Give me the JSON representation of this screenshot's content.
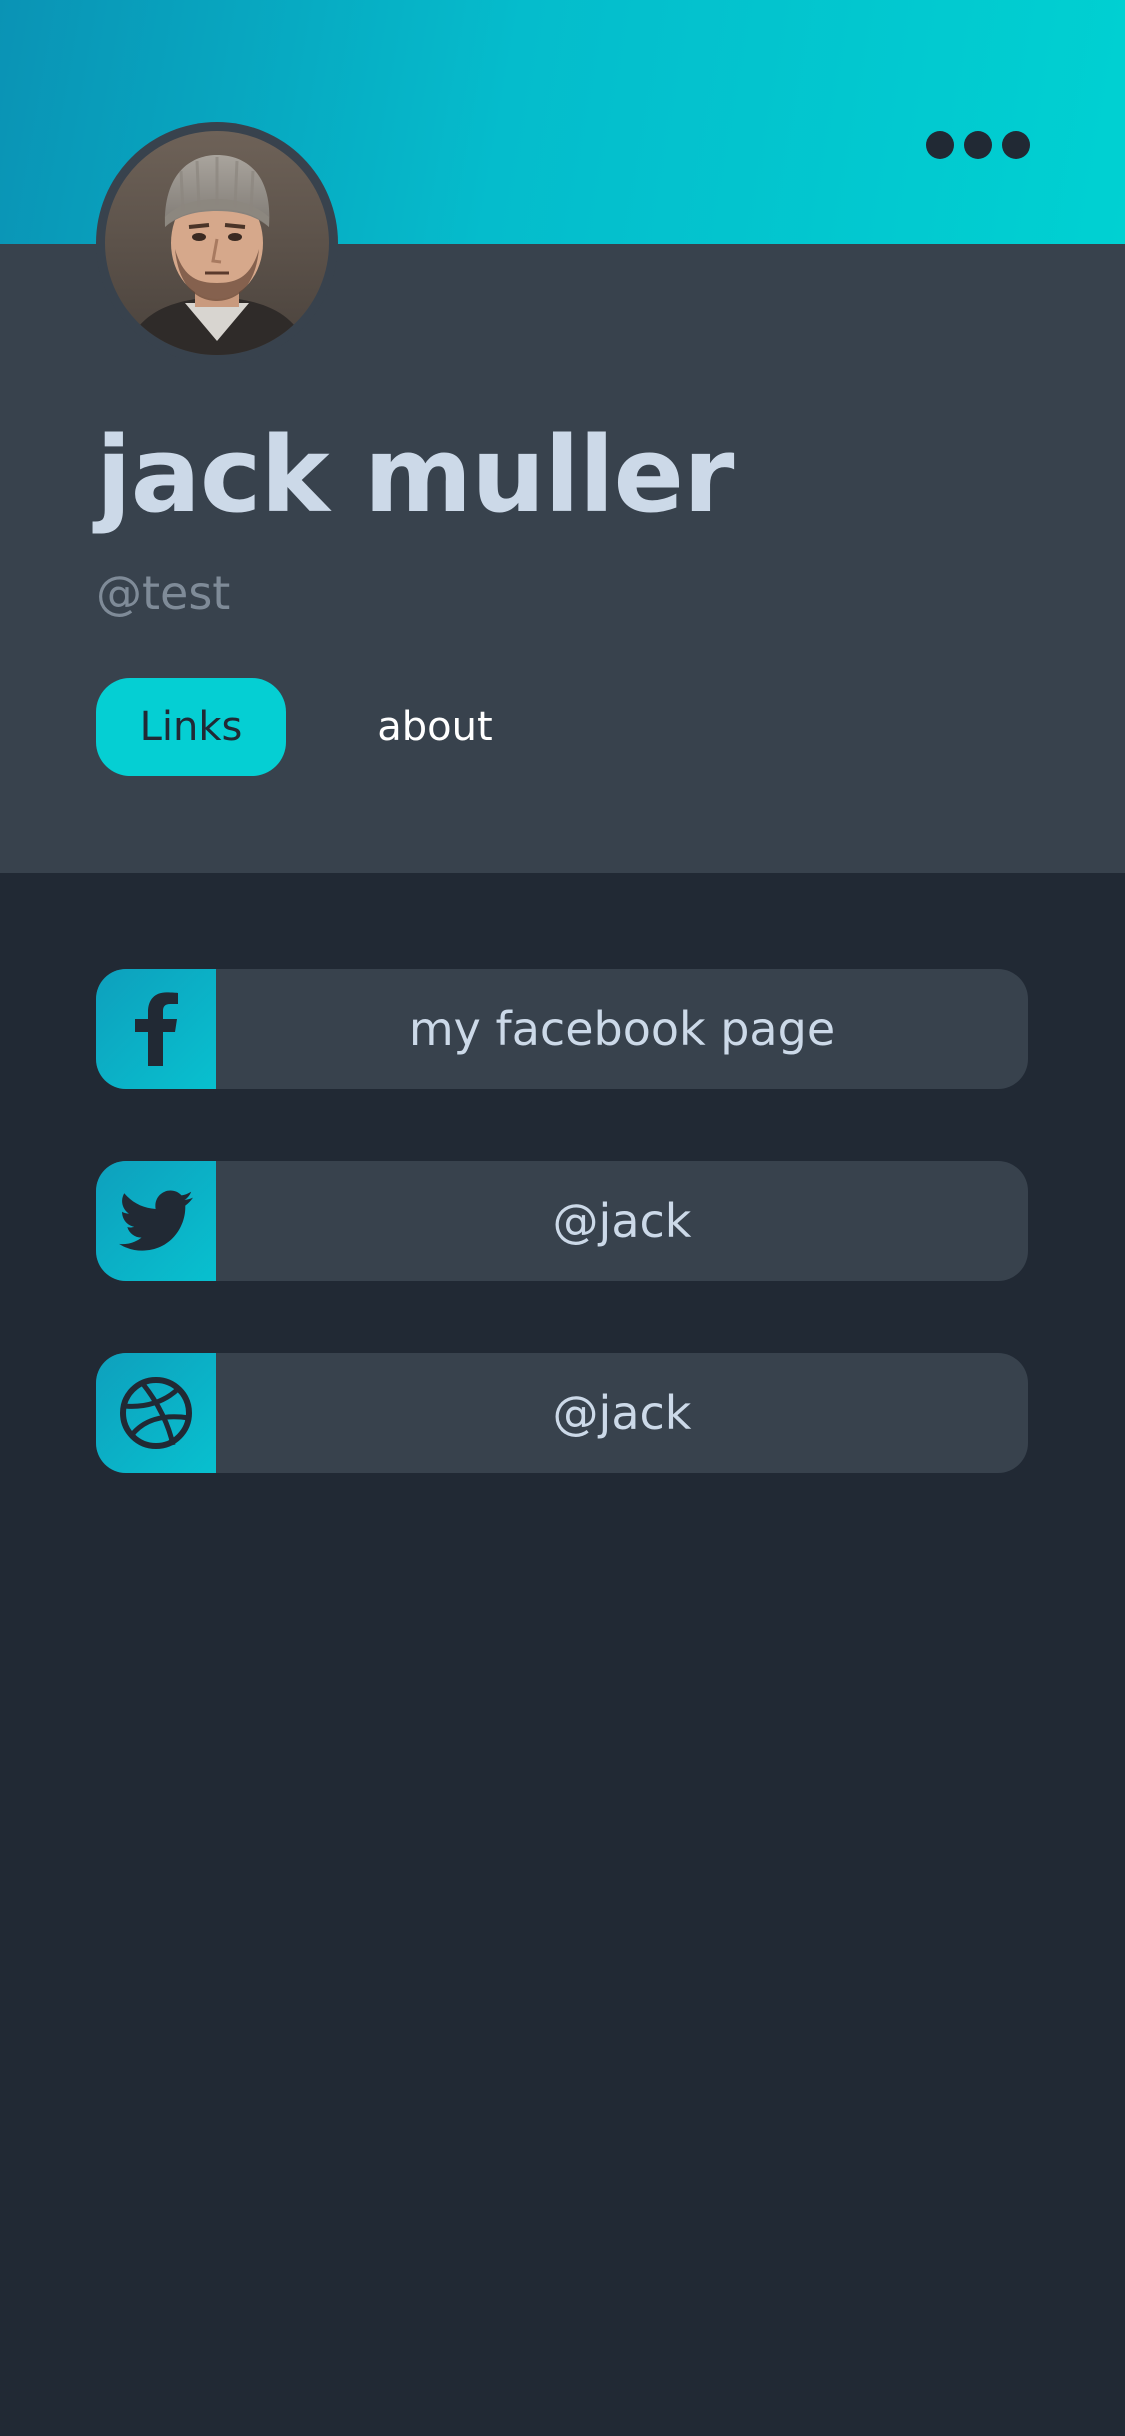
{
  "profile": {
    "name": "jack muller",
    "handle": "@test"
  },
  "tabs": [
    {
      "label": "Links",
      "active": true
    },
    {
      "label": "about",
      "active": false
    }
  ],
  "links": [
    {
      "icon": "facebook-icon",
      "label": "my facebook page"
    },
    {
      "icon": "twitter-icon",
      "label": "@jack"
    },
    {
      "icon": "dribbble-icon",
      "label": "@jack"
    }
  ],
  "colors": {
    "accent": "#05cfd3",
    "panel": "#38424d",
    "background": "#212934",
    "name_text": "#ccd9e8"
  }
}
